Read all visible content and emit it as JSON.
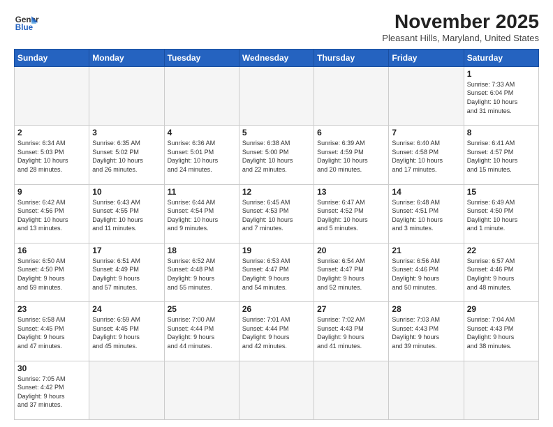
{
  "logo": {
    "line1": "General",
    "line2": "Blue"
  },
  "title": "November 2025",
  "subtitle": "Pleasant Hills, Maryland, United States",
  "weekdays": [
    "Sunday",
    "Monday",
    "Tuesday",
    "Wednesday",
    "Thursday",
    "Friday",
    "Saturday"
  ],
  "weeks": [
    [
      {
        "day": "",
        "info": ""
      },
      {
        "day": "",
        "info": ""
      },
      {
        "day": "",
        "info": ""
      },
      {
        "day": "",
        "info": ""
      },
      {
        "day": "",
        "info": ""
      },
      {
        "day": "",
        "info": ""
      },
      {
        "day": "1",
        "info": "Sunrise: 7:33 AM\nSunset: 6:04 PM\nDaylight: 10 hours\nand 31 minutes."
      }
    ],
    [
      {
        "day": "2",
        "info": "Sunrise: 6:34 AM\nSunset: 5:03 PM\nDaylight: 10 hours\nand 28 minutes."
      },
      {
        "day": "3",
        "info": "Sunrise: 6:35 AM\nSunset: 5:02 PM\nDaylight: 10 hours\nand 26 minutes."
      },
      {
        "day": "4",
        "info": "Sunrise: 6:36 AM\nSunset: 5:01 PM\nDaylight: 10 hours\nand 24 minutes."
      },
      {
        "day": "5",
        "info": "Sunrise: 6:38 AM\nSunset: 5:00 PM\nDaylight: 10 hours\nand 22 minutes."
      },
      {
        "day": "6",
        "info": "Sunrise: 6:39 AM\nSunset: 4:59 PM\nDaylight: 10 hours\nand 20 minutes."
      },
      {
        "day": "7",
        "info": "Sunrise: 6:40 AM\nSunset: 4:58 PM\nDaylight: 10 hours\nand 17 minutes."
      },
      {
        "day": "8",
        "info": "Sunrise: 6:41 AM\nSunset: 4:57 PM\nDaylight: 10 hours\nand 15 minutes."
      }
    ],
    [
      {
        "day": "9",
        "info": "Sunrise: 6:42 AM\nSunset: 4:56 PM\nDaylight: 10 hours\nand 13 minutes."
      },
      {
        "day": "10",
        "info": "Sunrise: 6:43 AM\nSunset: 4:55 PM\nDaylight: 10 hours\nand 11 minutes."
      },
      {
        "day": "11",
        "info": "Sunrise: 6:44 AM\nSunset: 4:54 PM\nDaylight: 10 hours\nand 9 minutes."
      },
      {
        "day": "12",
        "info": "Sunrise: 6:45 AM\nSunset: 4:53 PM\nDaylight: 10 hours\nand 7 minutes."
      },
      {
        "day": "13",
        "info": "Sunrise: 6:47 AM\nSunset: 4:52 PM\nDaylight: 10 hours\nand 5 minutes."
      },
      {
        "day": "14",
        "info": "Sunrise: 6:48 AM\nSunset: 4:51 PM\nDaylight: 10 hours\nand 3 minutes."
      },
      {
        "day": "15",
        "info": "Sunrise: 6:49 AM\nSunset: 4:50 PM\nDaylight: 10 hours\nand 1 minute."
      }
    ],
    [
      {
        "day": "16",
        "info": "Sunrise: 6:50 AM\nSunset: 4:50 PM\nDaylight: 9 hours\nand 59 minutes."
      },
      {
        "day": "17",
        "info": "Sunrise: 6:51 AM\nSunset: 4:49 PM\nDaylight: 9 hours\nand 57 minutes."
      },
      {
        "day": "18",
        "info": "Sunrise: 6:52 AM\nSunset: 4:48 PM\nDaylight: 9 hours\nand 55 minutes."
      },
      {
        "day": "19",
        "info": "Sunrise: 6:53 AM\nSunset: 4:47 PM\nDaylight: 9 hours\nand 54 minutes."
      },
      {
        "day": "20",
        "info": "Sunrise: 6:54 AM\nSunset: 4:47 PM\nDaylight: 9 hours\nand 52 minutes."
      },
      {
        "day": "21",
        "info": "Sunrise: 6:56 AM\nSunset: 4:46 PM\nDaylight: 9 hours\nand 50 minutes."
      },
      {
        "day": "22",
        "info": "Sunrise: 6:57 AM\nSunset: 4:46 PM\nDaylight: 9 hours\nand 48 minutes."
      }
    ],
    [
      {
        "day": "23",
        "info": "Sunrise: 6:58 AM\nSunset: 4:45 PM\nDaylight: 9 hours\nand 47 minutes."
      },
      {
        "day": "24",
        "info": "Sunrise: 6:59 AM\nSunset: 4:45 PM\nDaylight: 9 hours\nand 45 minutes."
      },
      {
        "day": "25",
        "info": "Sunrise: 7:00 AM\nSunset: 4:44 PM\nDaylight: 9 hours\nand 44 minutes."
      },
      {
        "day": "26",
        "info": "Sunrise: 7:01 AM\nSunset: 4:44 PM\nDaylight: 9 hours\nand 42 minutes."
      },
      {
        "day": "27",
        "info": "Sunrise: 7:02 AM\nSunset: 4:43 PM\nDaylight: 9 hours\nand 41 minutes."
      },
      {
        "day": "28",
        "info": "Sunrise: 7:03 AM\nSunset: 4:43 PM\nDaylight: 9 hours\nand 39 minutes."
      },
      {
        "day": "29",
        "info": "Sunrise: 7:04 AM\nSunset: 4:43 PM\nDaylight: 9 hours\nand 38 minutes."
      }
    ],
    [
      {
        "day": "30",
        "info": "Sunrise: 7:05 AM\nSunset: 4:42 PM\nDaylight: 9 hours\nand 37 minutes."
      },
      {
        "day": "",
        "info": ""
      },
      {
        "day": "",
        "info": ""
      },
      {
        "day": "",
        "info": ""
      },
      {
        "day": "",
        "info": ""
      },
      {
        "day": "",
        "info": ""
      },
      {
        "day": "",
        "info": ""
      }
    ]
  ]
}
